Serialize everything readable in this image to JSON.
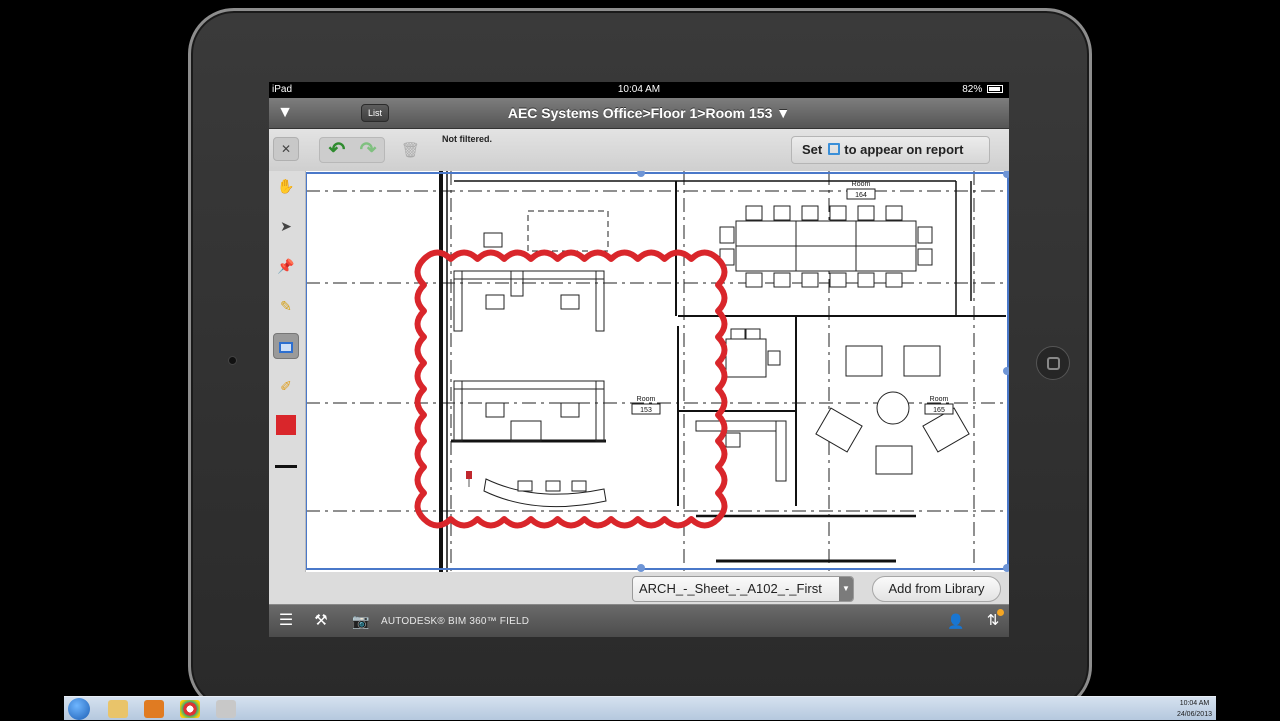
{
  "status_bar": {
    "device": "iPad",
    "time": "10:04 AM",
    "battery": "82%"
  },
  "nav": {
    "list_label": "List",
    "title": "AEC Systems Office>Floor 1>Room 153 ▼"
  },
  "toolbar": {
    "close_glyph": "✕",
    "filter_status": "Not filtered.",
    "set_label": "Set",
    "report_label": "to appear on report"
  },
  "tools": [
    {
      "name": "hand-tool-icon"
    },
    {
      "name": "select-tool-icon"
    },
    {
      "name": "pin-tool-icon"
    },
    {
      "name": "pencil-tool-icon"
    },
    {
      "name": "rectangle-tool-icon",
      "active": true
    },
    {
      "name": "highlighter-tool-icon"
    },
    {
      "name": "color-swatch",
      "color": "#d9262b"
    },
    {
      "name": "line-weight-icon"
    }
  ],
  "drawing": {
    "rooms": [
      {
        "label": "Room",
        "number": "164"
      },
      {
        "label": "Room",
        "number": "153"
      },
      {
        "label": "Room",
        "number": "165"
      }
    ],
    "markup_color": "#d9262b",
    "selection_color": "#4a78c9"
  },
  "sheet": {
    "selected": "ARCH_-_Sheet_-_A102_-_First",
    "add_label": "Add from Library"
  },
  "bottom_bar": {
    "brand": "AUTODESK® BIM 360™ FIELD"
  },
  "taskbar": {
    "time": "10:04 AM",
    "date": "24/06/2013"
  }
}
